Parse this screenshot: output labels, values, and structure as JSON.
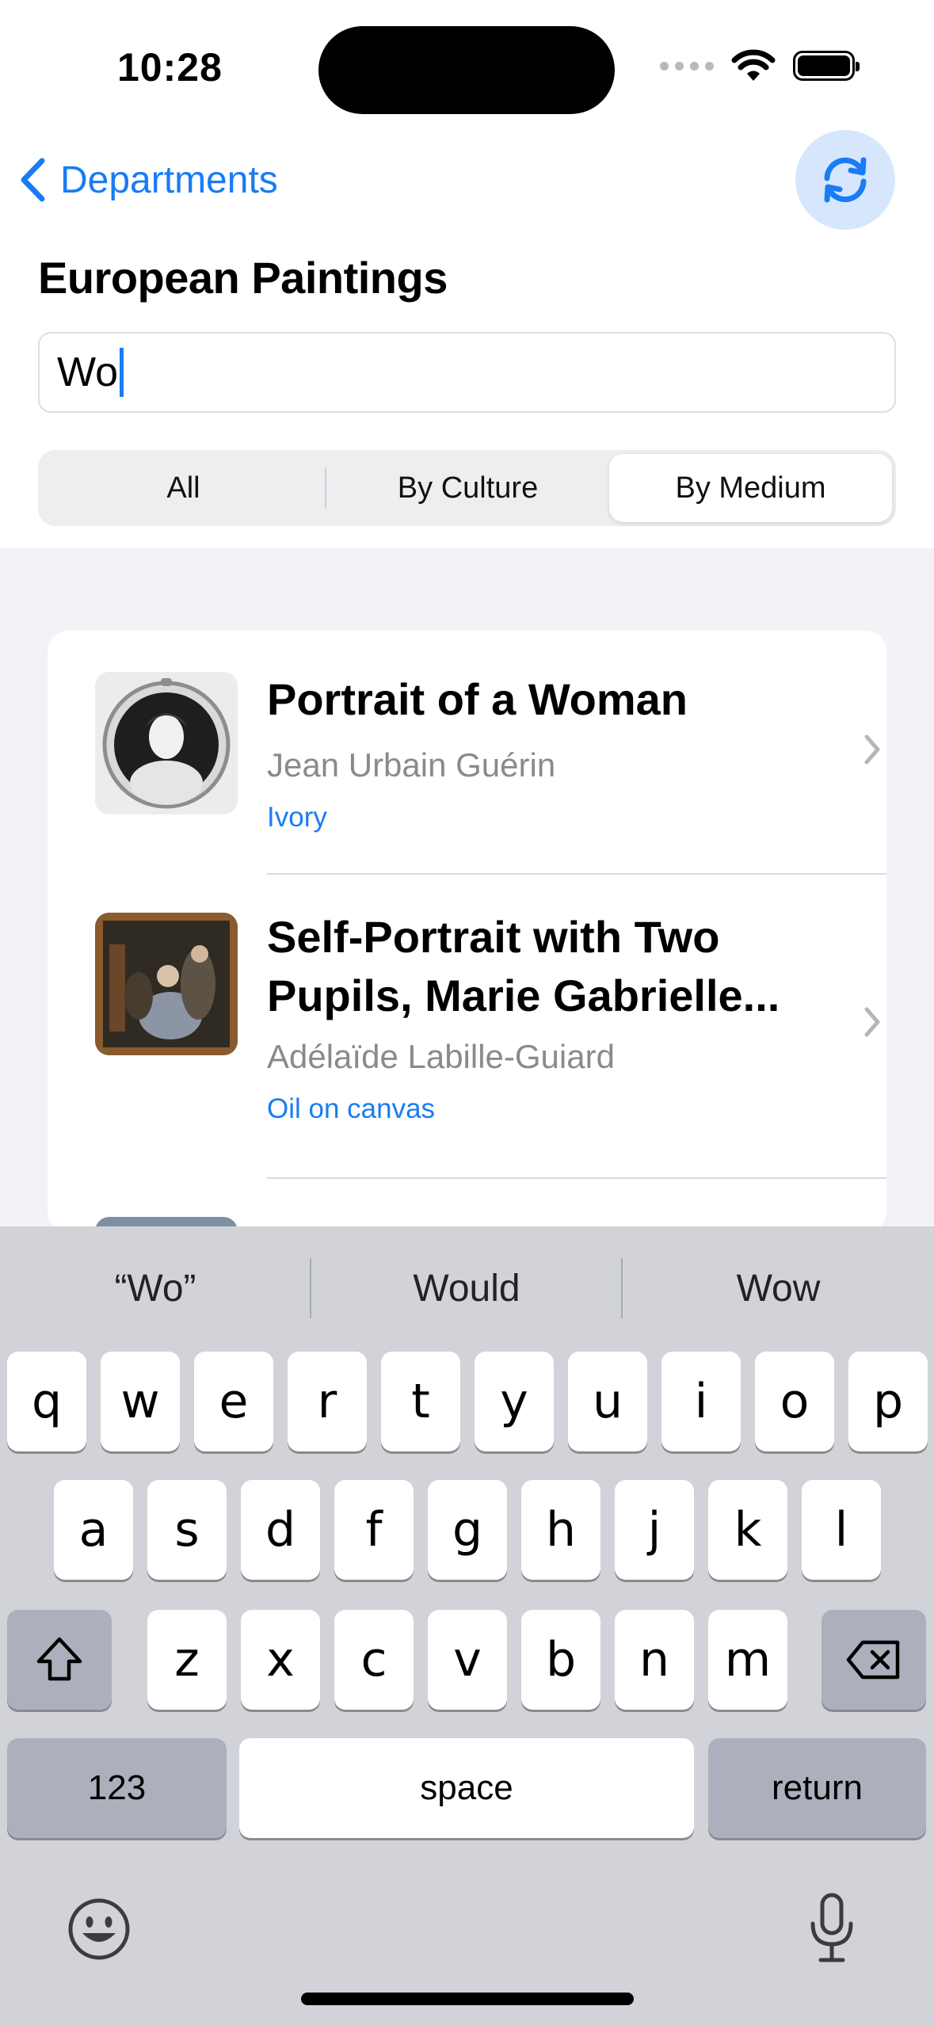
{
  "status_bar": {
    "time": "10:28"
  },
  "nav": {
    "back_label": "Departments",
    "title": "European Paintings"
  },
  "search": {
    "value": "Wo"
  },
  "segments": [
    {
      "label": "All",
      "selected": false
    },
    {
      "label": "By Culture",
      "selected": false
    },
    {
      "label": "By Medium",
      "selected": true
    }
  ],
  "results": [
    {
      "title_lines": [
        "Portrait of a Woman"
      ],
      "artist": "Jean Urbain Guérin",
      "medium": "Ivory"
    },
    {
      "title_lines": [
        "Self-Portrait with Two",
        "Pupils, Marie Gabrielle..."
      ],
      "artist": "Adélaïde Labille-Guiard",
      "medium": "Oil on canvas"
    }
  ],
  "keyboard": {
    "suggestions": [
      "“Wo”",
      "Would",
      "Wow"
    ],
    "row1": [
      "q",
      "w",
      "e",
      "r",
      "t",
      "y",
      "u",
      "i",
      "o",
      "p"
    ],
    "row2": [
      "a",
      "s",
      "d",
      "f",
      "g",
      "h",
      "j",
      "k",
      "l"
    ],
    "row3": [
      "z",
      "x",
      "c",
      "v",
      "b",
      "n",
      "m"
    ],
    "numbers_label": "123",
    "space_label": "space",
    "return_label": "return"
  },
  "colors": {
    "accent": "#1a7cf4",
    "keyboard_bg": "#d1d3d9",
    "list_bg": "#f2f2f7"
  }
}
